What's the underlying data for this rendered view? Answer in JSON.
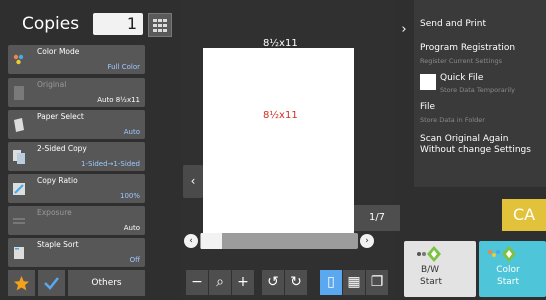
{
  "header": {
    "copies_label": "Copies",
    "copies_count": "1",
    "keypad_icon": "keypad-icon"
  },
  "settings": [
    {
      "label": "Color Mode",
      "value": "Full Color",
      "enabled": true,
      "icon": "color-mode-icon"
    },
    {
      "label": "Original",
      "value": "Auto 8½x11",
      "enabled": false,
      "icon": "original-icon"
    },
    {
      "label": "Paper Select",
      "value": "Auto",
      "enabled": true,
      "icon": "paper-select-icon"
    },
    {
      "label": "2-Sided Copy",
      "value": "1-Sided→1-Sided",
      "enabled": true,
      "icon": "two-sided-icon"
    },
    {
      "label": "Copy Ratio",
      "value": "100%",
      "enabled": true,
      "icon": "copy-ratio-icon"
    },
    {
      "label": "Exposure",
      "value": "Auto",
      "enabled": false,
      "icon": "exposure-icon"
    },
    {
      "label": "Staple Sort",
      "value": "Off",
      "enabled": true,
      "icon": "staple-sort-icon"
    }
  ],
  "bottom_left": {
    "others_label": "Others",
    "favorite_icon": "star-icon",
    "check_icon": "checkmark-icon"
  },
  "preview": {
    "top_size": "8½x11",
    "center_size": "8½x11",
    "page_counter": "1/7"
  },
  "right_menu": {
    "send_and_print": "Send and Print",
    "program_registration": "Program Registration",
    "program_registration_sub": "Register Current Settings",
    "quick_file": "Quick File",
    "quick_file_sub": "Store Data Temporarily",
    "file": "File",
    "file_sub": "Store Data in Folder",
    "scan_again_line1": "Scan Original Again",
    "scan_again_line2": "Without change Settings"
  },
  "start": {
    "color_abbrev": "CA",
    "bw_line1": "B/W",
    "bw_line2": "Start",
    "color_line1": "Color",
    "color_line2": "Start"
  },
  "colors": {
    "background": "#2f2f2f",
    "setting_tile": "#575757",
    "value_text": "#9ec9ff",
    "size_red": "#d52b1e",
    "ca_yellow": "#e2c23a",
    "color_start": "#4ec5d8",
    "bw_start": "#e3e3e3"
  }
}
